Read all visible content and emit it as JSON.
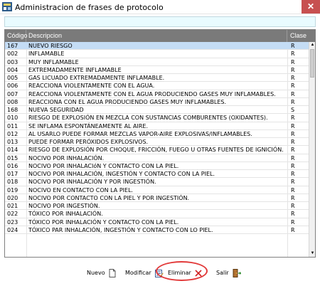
{
  "window": {
    "title": "Administracion de frases de protocolo",
    "close_label": "✕"
  },
  "grid": {
    "headers": {
      "code": "Código",
      "desc": "Descripcion",
      "clase": "Clase"
    },
    "rows": [
      {
        "code": "167",
        "desc": "NUEVO RIESGO",
        "clase": "R"
      },
      {
        "code": "002",
        "desc": "INFLAMABLE",
        "clase": "R"
      },
      {
        "code": "003",
        "desc": "MUY INFLAMABLE",
        "clase": "R"
      },
      {
        "code": "004",
        "desc": "EXTREMADAMENTE INFLAMABLE",
        "clase": "R"
      },
      {
        "code": "005",
        "desc": "GAS LICUADO EXTREMADAMENTE INFLAMABLE.",
        "clase": "R"
      },
      {
        "code": "006",
        "desc": "REACCIONA VIOLENTAMENTE CON EL AGUA.",
        "clase": "R"
      },
      {
        "code": "007",
        "desc": "REACCIONA VIOLENTAMENTE CON EL AGUA PRODUCIENDO GASES MUY INFLAMABLES.",
        "clase": "R"
      },
      {
        "code": "008",
        "desc": "REACCIONA CON EL AGUA PRODUCIENDO GASES MUY INFLAMABLES.",
        "clase": "R"
      },
      {
        "code": "168",
        "desc": "NUEVA SEGURIDAD",
        "clase": "S"
      },
      {
        "code": "010",
        "desc": "RIESGO DE EXPLOSIÓN EN MEZCLA CON SUSTANCIAS COMBURENTES (OXIDANTES).",
        "clase": "R"
      },
      {
        "code": "011",
        "desc": "SE INFLAMA ESPONTÁNEAMENTE AL AIRE.",
        "clase": "R"
      },
      {
        "code": "012",
        "desc": "AL USARLO PUEDE FORMAR MEZCLAS VAPOR-AIRE EXPLOSIVAS/INFLAMABLES.",
        "clase": "R"
      },
      {
        "code": "013",
        "desc": "PUEDE FORMAR PERÓXIDOS EXPLOSIVOS.",
        "clase": "R"
      },
      {
        "code": "014",
        "desc": "RIESGO DE EXPLOSIÓN POR CHOQUE, FRICCIÓN, FUEGO U OTRAS FUENTES DE IGNICIÓN.",
        "clase": "R"
      },
      {
        "code": "015",
        "desc": "NOCIVO POR INHALACIÓN.",
        "clase": "R"
      },
      {
        "code": "016",
        "desc": "NOCIVO POR INHALACIóN Y CONTACTO CON LA PIEL.",
        "clase": "R"
      },
      {
        "code": "017",
        "desc": "NOCIVO POR INHALACIÓN, INGESTIÓN Y CONTACTO CON LA PIEL.",
        "clase": "R"
      },
      {
        "code": "018",
        "desc": "NOCIVO POR INHALACIÓN Y POR INGESTIÓN.",
        "clase": "R"
      },
      {
        "code": "019",
        "desc": "NOCIVO EN CONTACTO CON LA PIEL.",
        "clase": "R"
      },
      {
        "code": "020",
        "desc": "NOCIVO POR CONTACTO CON LA PIEL Y POR INGESTIÓN.",
        "clase": "R"
      },
      {
        "code": "021",
        "desc": "NOCIVO POR INGESTIÓN.",
        "clase": "R"
      },
      {
        "code": "022",
        "desc": "TÓXICO POR INHALACIÓN.",
        "clase": "R"
      },
      {
        "code": "023",
        "desc": "TÓXICO POR INHALACIÓN Y CONTACTO CON LA PIEL.",
        "clase": "R"
      },
      {
        "code": "024",
        "desc": "TÓXICO PAR INHALACIÓN, INGESTIÓN Y CONTACTO CON LO PIEL.",
        "clase": "R"
      }
    ]
  },
  "buttons": {
    "nuevo": "Nuevo",
    "modificar": "Modificar",
    "eliminar": "Eliminar",
    "salir": "Salir"
  },
  "icons": {
    "app": "app-icon",
    "nuevo": "new-document-icon",
    "modificar": "edit-icon",
    "eliminar": "delete-x-icon",
    "salir": "exit-door-icon"
  },
  "colors": {
    "selected_row": "#c4dcf5",
    "header_bg": "#7a7a7a",
    "search_bg": "#e9fbff",
    "close_bg": "#c75050",
    "highlight_oval": "#e23a3a"
  }
}
